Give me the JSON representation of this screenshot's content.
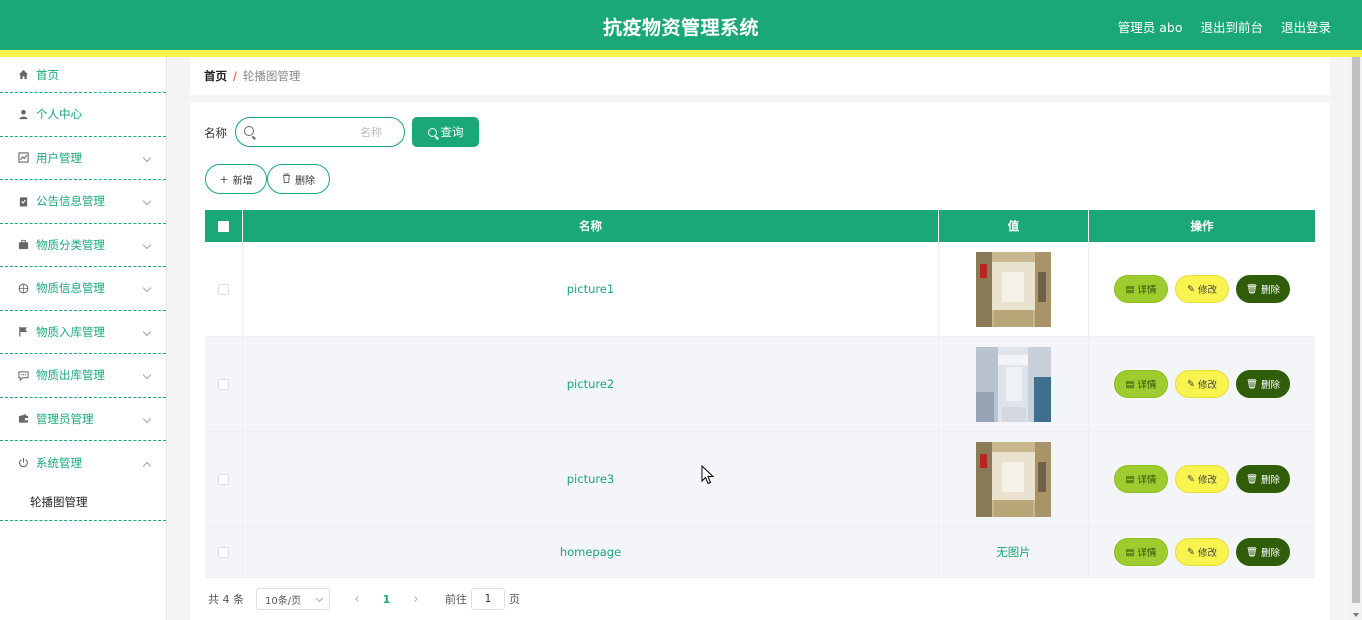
{
  "header": {
    "title": "抗疫物资管理系统",
    "admin_label": "管理员 abo",
    "to_front": "退出到前台",
    "logout": "退出登录"
  },
  "colors": {
    "primary": "#1aa877",
    "accent_yellow": "#f8f34f",
    "detail_btn": "#9ecb2e",
    "delete_btn": "#2f5d09"
  },
  "sidebar": {
    "items": [
      {
        "label": "首页",
        "icon": "home-icon",
        "has_arrow": false
      },
      {
        "label": "个人中心",
        "icon": "user-icon",
        "has_arrow": false
      },
      {
        "label": "用户管理",
        "icon": "chart-icon",
        "has_arrow": true
      },
      {
        "label": "公告信息管理",
        "icon": "clipboard-icon",
        "has_arrow": true
      },
      {
        "label": "物质分类管理",
        "icon": "briefcase-icon",
        "has_arrow": true
      },
      {
        "label": "物质信息管理",
        "icon": "compass-icon",
        "has_arrow": true
      },
      {
        "label": "物质入库管理",
        "icon": "flag-icon",
        "has_arrow": true
      },
      {
        "label": "物质出库管理",
        "icon": "chat-icon",
        "has_arrow": true
      },
      {
        "label": "管理员管理",
        "icon": "wallet-icon",
        "has_arrow": true
      },
      {
        "label": "系统管理",
        "icon": "power-icon",
        "has_arrow": true,
        "expanded": true
      }
    ],
    "submenu": {
      "label": "轮播图管理"
    }
  },
  "breadcrumb": {
    "home": "首页",
    "separator": "/",
    "current": "轮播图管理"
  },
  "search": {
    "label": "名称",
    "placeholder": "名称",
    "value": "",
    "button": "查询"
  },
  "actions": {
    "add": "新增",
    "delete": "删除"
  },
  "table": {
    "headers": {
      "name": "名称",
      "value": "值",
      "ops": "操作"
    },
    "rows": [
      {
        "name": "picture1",
        "image": "corridor-warm"
      },
      {
        "name": "picture2",
        "image": "corridor-cool"
      },
      {
        "name": "picture3",
        "image": "corridor-warm"
      },
      {
        "name": "homepage",
        "value_text": "无图片"
      }
    ],
    "ops": {
      "detail": "详情",
      "edit": "修改",
      "delete": "删除"
    }
  },
  "pagination": {
    "total": "共 4 条",
    "page_size": "10条/页",
    "current_page": "1",
    "goto_prefix": "前往",
    "goto_value": "1",
    "goto_suffix": "页"
  }
}
